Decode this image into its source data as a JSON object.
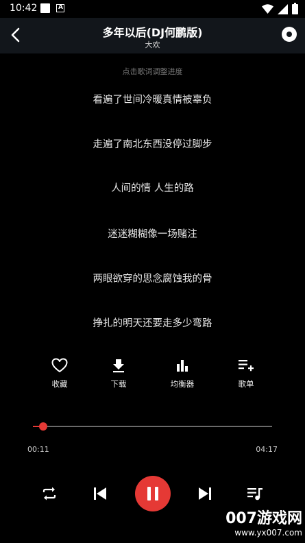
{
  "status_bar": {
    "time": "10:42"
  },
  "header": {
    "title": "多年以后(DJ何鹏版)",
    "artist": "大欢"
  },
  "lyrics": {
    "hint": "点击歌词调整进度",
    "lines": [
      "看遍了世间冷暖真情被辜负",
      "走遍了南北东西没停过脚步",
      "人间的情 人生的路",
      "迷迷糊糊像一场赌注",
      "两眼欲穿的思念腐蚀我的骨",
      "挣扎的明天还要走多少弯路"
    ]
  },
  "actions": [
    {
      "label": "收藏",
      "icon": "heart-icon"
    },
    {
      "label": "下载",
      "icon": "download-icon"
    },
    {
      "label": "均衡器",
      "icon": "equalizer-icon"
    },
    {
      "label": "歌单",
      "icon": "playlist-add-icon"
    }
  ],
  "playback": {
    "current_time": "00:11",
    "total_time": "04:17",
    "progress": 0.043,
    "accent_color": "#e53935"
  },
  "controls": [
    "repeat-icon",
    "skip-previous-icon",
    "pause-icon",
    "skip-next-icon",
    "queue-music-icon"
  ],
  "watermark": {
    "brand": "007游戏网",
    "url": "www.yx007.com"
  }
}
